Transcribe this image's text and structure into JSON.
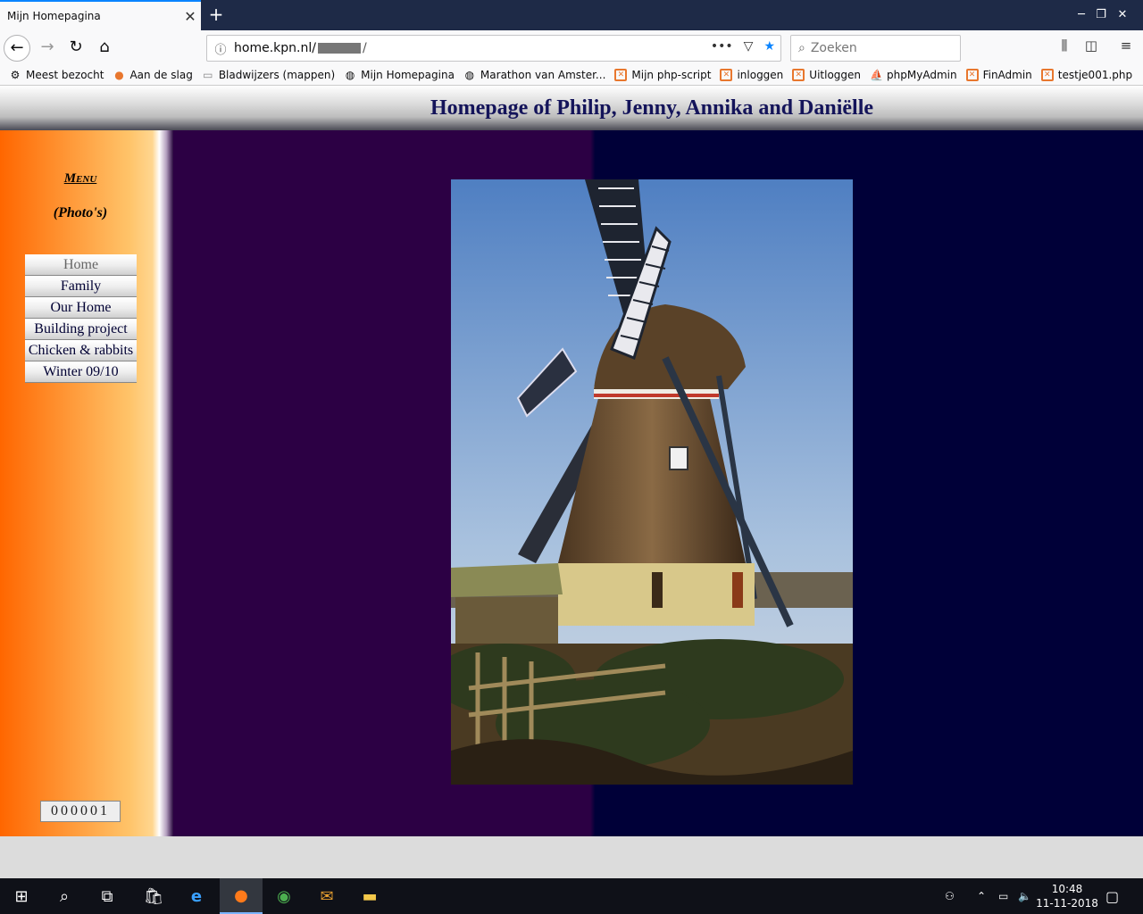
{
  "browser": {
    "tab_title": "Mijn Homepagina",
    "tab_close": "✕",
    "new_tab": "+",
    "url_host": "home.kpn.nl/",
    "url_suffix": "/",
    "search_placeholder": "Zoeken",
    "window_controls": [
      "─",
      "❐",
      "✕"
    ],
    "bookmarks": [
      {
        "label": "Meest bezocht",
        "icon": "gear-icon"
      },
      {
        "label": "Aan de slag",
        "icon": "firefox-icon"
      },
      {
        "label": "Bladwijzers (mappen)",
        "icon": "folder-icon"
      },
      {
        "label": "Mijn Homepagina",
        "icon": "globe-icon"
      },
      {
        "label": "Marathon van Amster...",
        "icon": "globe-icon"
      },
      {
        "label": "Mijn php-script",
        "icon": "xampp-icon"
      },
      {
        "label": "inloggen",
        "icon": "xampp-icon"
      },
      {
        "label": "Uitloggen",
        "icon": "xampp-icon"
      },
      {
        "label": "phpMyAdmin",
        "icon": "phpmyadmin-icon"
      },
      {
        "label": "FinAdmin",
        "icon": "xampp-icon"
      },
      {
        "label": "testje001.php",
        "icon": "xampp-icon"
      }
    ]
  },
  "page": {
    "title": "Homepage of Philip, Jenny, Annika and Daniëlle",
    "menu_title": "Menu",
    "menu_subtitle": "(Photo's)",
    "menu_items": [
      {
        "label": "Home",
        "active": true
      },
      {
        "label": "Family",
        "active": false
      },
      {
        "label": "Our Home",
        "active": false
      },
      {
        "label": "Building project",
        "active": false
      },
      {
        "label": "Chicken & rabbits",
        "active": false
      },
      {
        "label": "Winter 09/10",
        "active": false
      }
    ],
    "counter": "000001"
  },
  "taskbar": {
    "time": "10:48",
    "date": "11-11-2018"
  },
  "colors": {
    "header_text": "#14145a",
    "sidebar_orange": "#ff6600",
    "main_purple": "#2c0044",
    "main_navy": "#000038",
    "firefox_blue": "#0a84ff"
  }
}
